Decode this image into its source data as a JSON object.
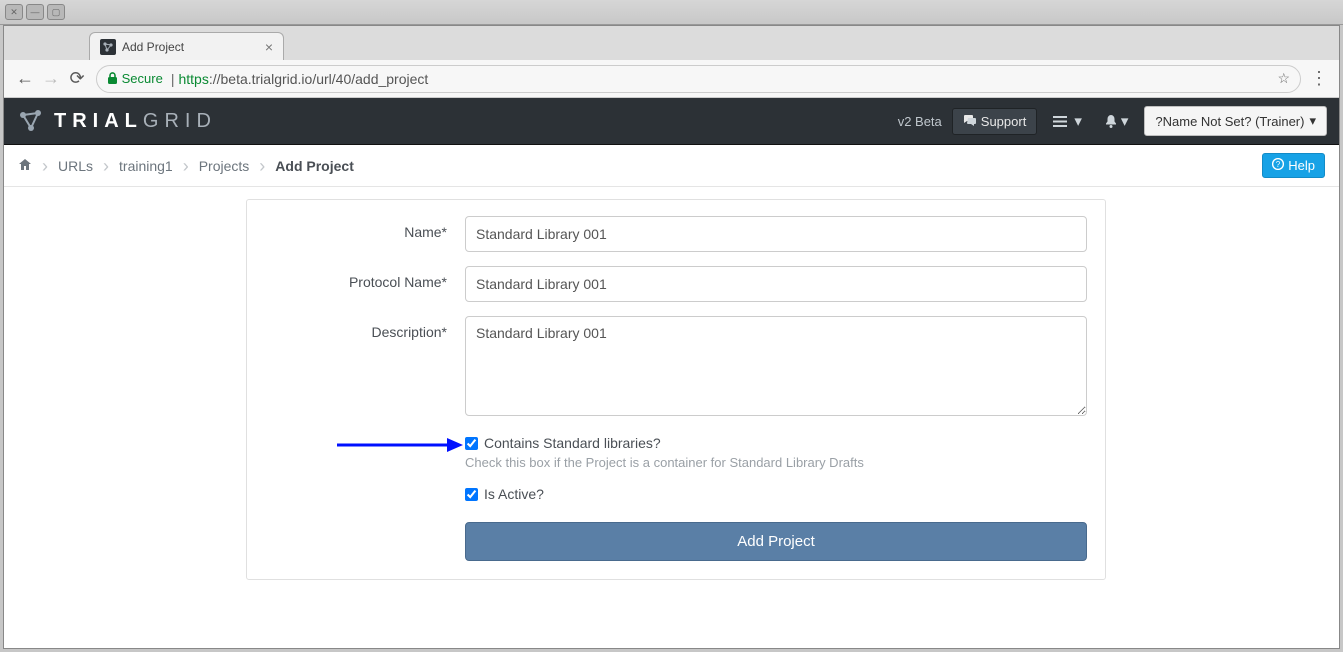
{
  "window": {
    "tab_title": "Add Project"
  },
  "browser": {
    "secure_label": "Secure",
    "url_scheme": "https",
    "url_host": "://beta.trialgrid.io",
    "url_path": "/url/40/add_project"
  },
  "navbar": {
    "brand_bold": "TRIAL",
    "brand_light": "GRID",
    "v2_label": "v2 Beta",
    "support_label": "Support",
    "user_label": "?Name Not Set? (Trainer)"
  },
  "breadcrumbs": {
    "items": [
      "URLs",
      "training1",
      "Projects",
      "Add Project"
    ],
    "help_label": "Help"
  },
  "form": {
    "name_label": "Name*",
    "name_value": "Standard Library 001",
    "protocol_label": "Protocol Name*",
    "protocol_value": "Standard Library 001",
    "description_label": "Description*",
    "description_value": "Standard Library 001",
    "contains_label": "Contains Standard libraries?",
    "contains_checked": true,
    "contains_help": "Check this box if the Project is a container for Standard Library Drafts",
    "active_label": "Is Active?",
    "active_checked": true,
    "submit_label": "Add Project"
  }
}
